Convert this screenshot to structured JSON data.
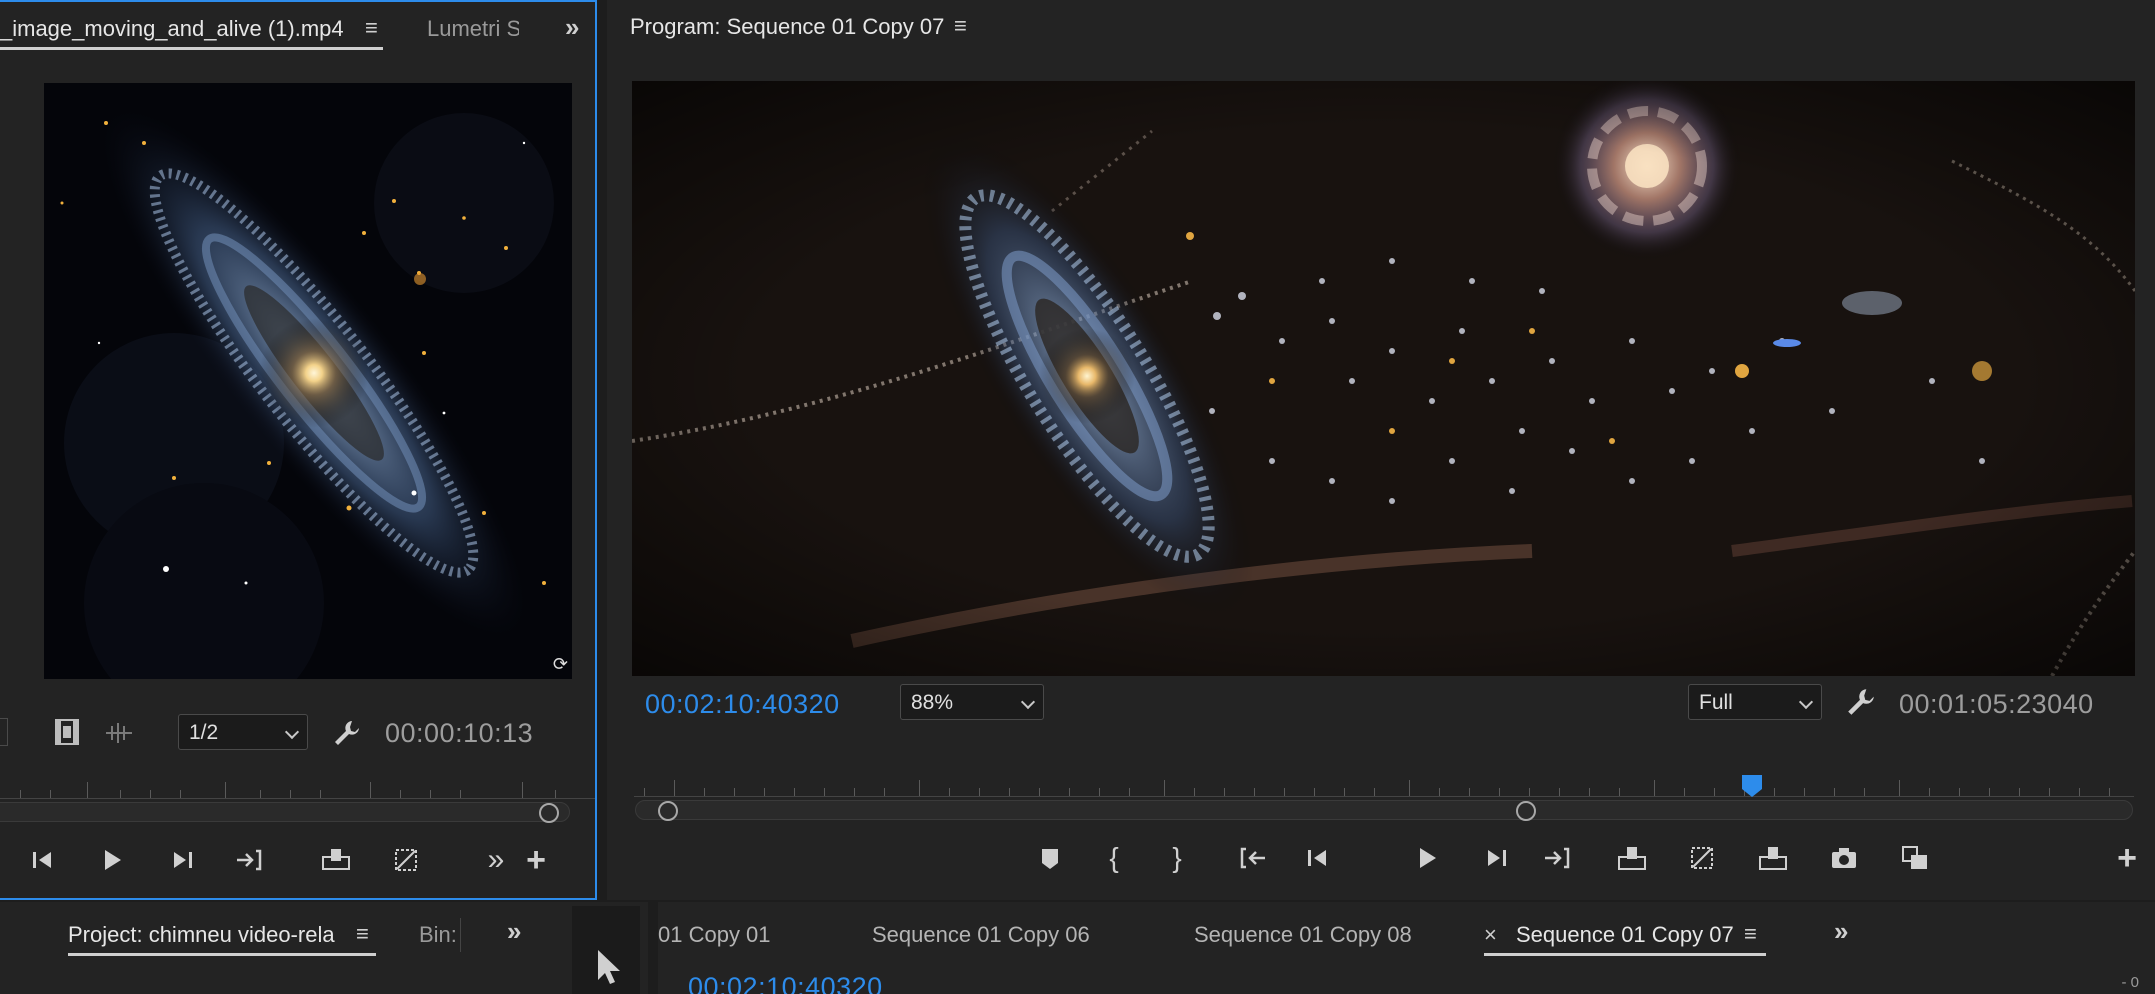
{
  "source_monitor": {
    "active_tab": "_image_moving_and_alive (1).mp4",
    "menu_icon": "hamburger-menu-icon",
    "second_tab": "Lumetri S",
    "overflow_icon": "double-chevron-right-icon",
    "resolution": "1/2",
    "timecode": "00:00:10:13"
  },
  "program_monitor": {
    "title": "Program: Sequence 01 Copy 07",
    "menu_icon": "hamburger-menu-icon",
    "playhead_timecode": "00:02:10:40320",
    "zoom": "88%",
    "quality": "Full",
    "duration_timecode": "00:01:05:23040",
    "playhead_position": 0.745
  },
  "project_panel": {
    "tab_label": "Project: chimneu video-rela",
    "bin_tab": "Bin:",
    "overflow_icon": "double-chevron-right-icon"
  },
  "timeline": {
    "tabs": [
      {
        "label": "01 Copy 01"
      },
      {
        "label": "Sequence 01 Copy 06"
      },
      {
        "label": "Sequence 01 Copy 08"
      },
      {
        "label": "Sequence 01 Copy 07",
        "active": true
      }
    ],
    "close_icon": "×",
    "timecode": "00:02:10:40320",
    "meter_label": "- 0"
  },
  "colors": {
    "accent": "#2d8ceb",
    "panel_bg": "#232323",
    "text": "#c8c8c8"
  }
}
